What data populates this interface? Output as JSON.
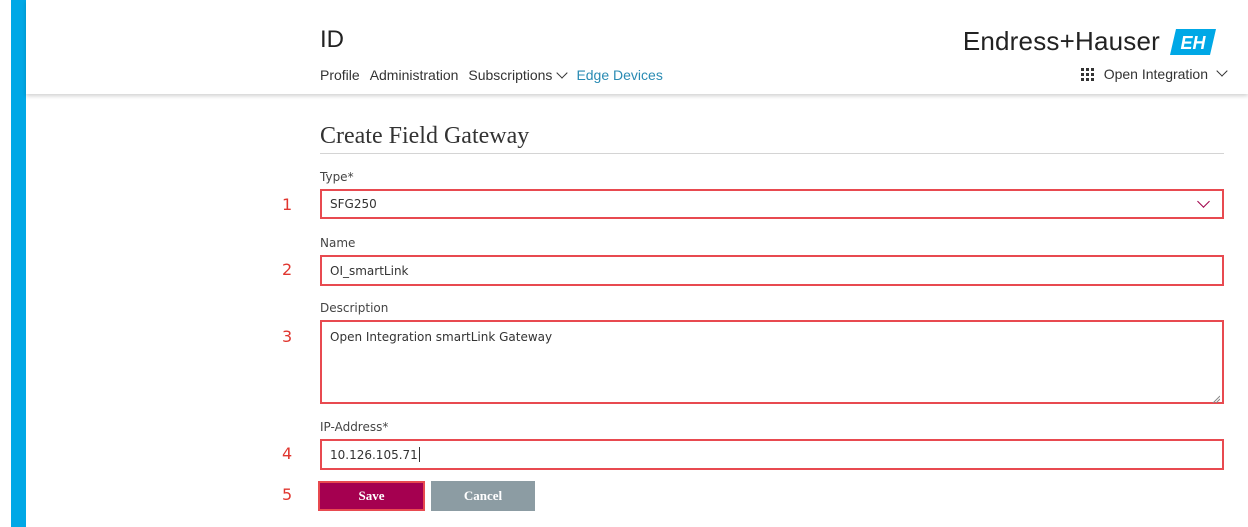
{
  "header": {
    "app_title": "ID",
    "nav": [
      "Profile",
      "Administration",
      "Subscriptions",
      "Edge Devices"
    ],
    "brand": "Endress+Hauser",
    "brand_logo": "EH",
    "app_switcher_label": "Open Integration"
  },
  "form": {
    "title": "Create Field Gateway",
    "type": {
      "label": "Type*",
      "value": "SFG250"
    },
    "name": {
      "label": "Name",
      "value": "OI_smartLink"
    },
    "description": {
      "label": "Description",
      "value": "Open Integration smartLink Gateway"
    },
    "ip": {
      "label": "IP-Address*",
      "value": "10.126.105.71"
    },
    "save_label": "Save",
    "cancel_label": "Cancel"
  },
  "annotations": [
    "1",
    "2",
    "3",
    "4",
    "5"
  ],
  "colors": {
    "sidebar_accent": "#00a8e6",
    "active_nav": "#2a8bb3",
    "primary_button": "#a50050",
    "secondary_button": "#8c9ca3",
    "highlight_border": "#e84a50",
    "annotation_number": "#e0362f",
    "logo_blue": "#00a8e6"
  }
}
